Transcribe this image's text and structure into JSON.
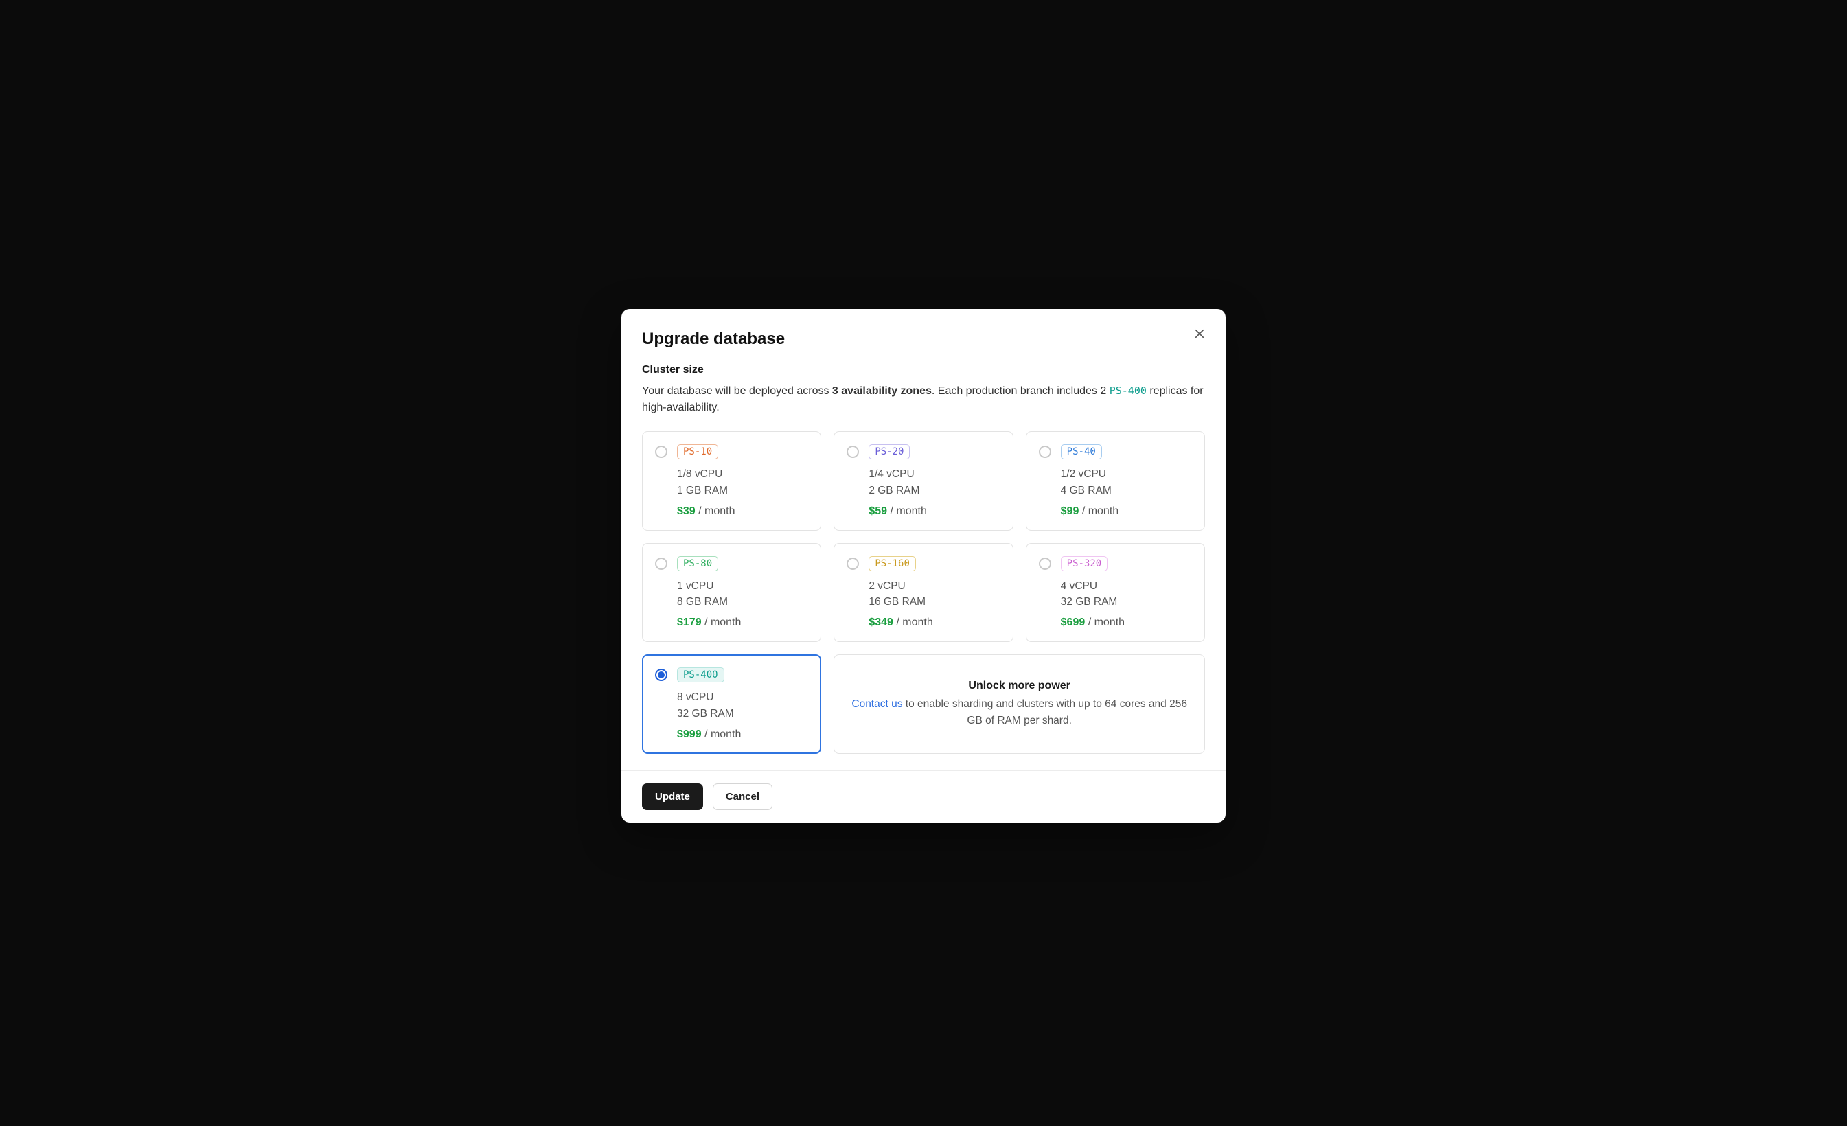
{
  "modal": {
    "title": "Upgrade database",
    "section_label": "Cluster size",
    "description_pre": "Your database will be deployed across ",
    "description_zones": "3 availability zones",
    "description_mid": ". Each production branch includes 2 ",
    "description_tier": "PS-400",
    "description_post": " replicas for high-availability.",
    "plans": [
      {
        "id": "ps-10",
        "name": "PS-10",
        "cpu": "1/8 vCPU",
        "ram": "1 GB RAM",
        "price": "$39",
        "per": "/ month",
        "badge_color": "#e06a2b",
        "badge_bg": "#ffffff",
        "badge_border": "#f0b695",
        "selected": false
      },
      {
        "id": "ps-20",
        "name": "PS-20",
        "cpu": "1/4 vCPU",
        "ram": "2 GB RAM",
        "price": "$59",
        "per": "/ month",
        "badge_color": "#6b5fd8",
        "badge_bg": "#ffffff",
        "badge_border": "#c7c0f0",
        "selected": false
      },
      {
        "id": "ps-40",
        "name": "PS-40",
        "cpu": "1/2 vCPU",
        "ram": "4 GB RAM",
        "price": "$99",
        "per": "/ month",
        "badge_color": "#2f7bd8",
        "badge_bg": "#ffffff",
        "badge_border": "#a8cdf0",
        "selected": false
      },
      {
        "id": "ps-80",
        "name": "PS-80",
        "cpu": "1 vCPU",
        "ram": "8 GB RAM",
        "price": "$179",
        "per": "/ month",
        "badge_color": "#2fae5f",
        "badge_bg": "#ffffff",
        "badge_border": "#a8e0bd",
        "selected": false
      },
      {
        "id": "ps-160",
        "name": "PS-160",
        "cpu": "2 vCPU",
        "ram": "16 GB RAM",
        "price": "$349",
        "per": "/ month",
        "badge_color": "#c99a1f",
        "badge_bg": "#ffffff",
        "badge_border": "#e8d28a",
        "selected": false
      },
      {
        "id": "ps-320",
        "name": "PS-320",
        "cpu": "4 vCPU",
        "ram": "32 GB RAM",
        "price": "$699",
        "per": "/ month",
        "badge_color": "#c95fcf",
        "badge_bg": "#ffffff",
        "badge_border": "#f0c5f2",
        "selected": false
      },
      {
        "id": "ps-400",
        "name": "PS-400",
        "cpu": "8 vCPU",
        "ram": "32 GB RAM",
        "price": "$999",
        "per": "/ month",
        "badge_color": "#0d9d8d",
        "badge_bg": "#e5f6f4",
        "badge_border": "#b7e6e0",
        "selected": true
      }
    ],
    "unlock": {
      "title": "Unlock more power",
      "link_text": "Contact us",
      "rest": " to enable sharding and clusters with up to 64 cores and 256 GB of RAM per shard."
    },
    "footer": {
      "update": "Update",
      "cancel": "Cancel"
    }
  }
}
